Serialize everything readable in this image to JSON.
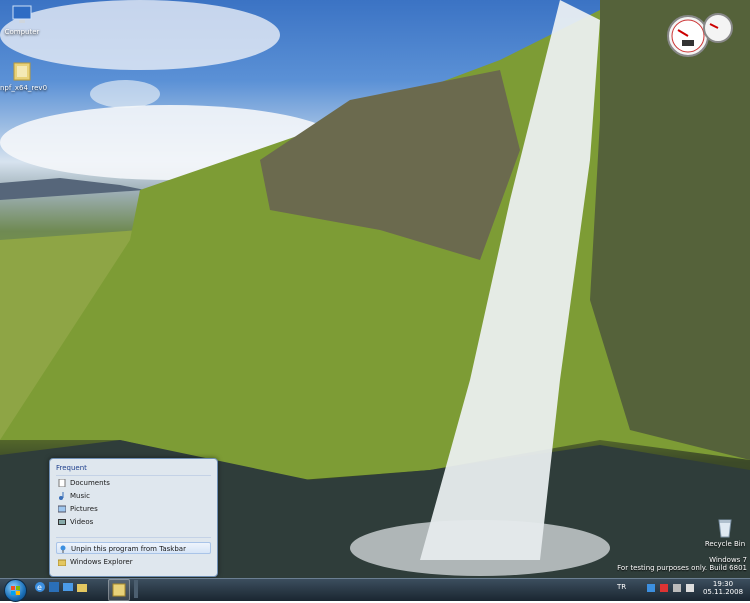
{
  "desktop": {
    "icons": [
      {
        "label": "Computer",
        "icon": "computer-icon"
      },
      {
        "label": "npf_x64_rev0",
        "icon": "folder-icon"
      },
      {
        "label": "Recycle Bin",
        "icon": "recycle-bin-icon"
      }
    ]
  },
  "jumplist": {
    "frequent_header": "Frequent",
    "items": [
      {
        "label": "Documents",
        "icon": "document-icon"
      },
      {
        "label": "Music",
        "icon": "music-icon"
      },
      {
        "label": "Pictures",
        "icon": "pictures-icon"
      },
      {
        "label": "Videos",
        "icon": "videos-icon"
      }
    ],
    "tasks": [
      {
        "label": "Unpin this program from Taskbar",
        "icon": "unpin-icon"
      },
      {
        "label": "Windows Explorer",
        "icon": "explorer-icon"
      }
    ]
  },
  "watermark": {
    "line1": "Windows 7",
    "line2": "For testing purposes only. Build 6801"
  },
  "tray": {
    "language": "TR",
    "time": "19:30",
    "date": "05.11.2008"
  },
  "colors": {
    "taskbar": "#1a2631",
    "jumplist_bg": "#ebf2fa",
    "header_text": "#1e3f8c"
  }
}
